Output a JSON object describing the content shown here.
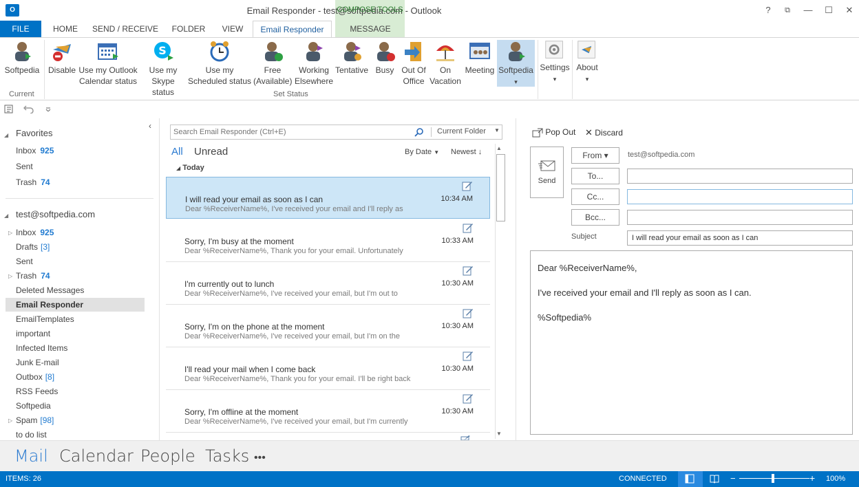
{
  "window": {
    "title": "Email Responder - test@softpedia.com - Outlook",
    "app_logo": "O",
    "contextual_tab_group": "COMPOSE TOOLS",
    "controls": {
      "help": "?",
      "ribbon_display": "⧉",
      "minimize": "—",
      "maximize": "☐",
      "close": "✕"
    }
  },
  "tabs": [
    "FILE",
    "HOME",
    "SEND / RECEIVE",
    "FOLDER",
    "VIEW",
    "Email Responder",
    "MESSAGE"
  ],
  "ribbon": {
    "current_group": "Current",
    "set_status_group": "Set Status",
    "buttons": [
      {
        "label1": "Softpedia",
        "label2": "",
        "icon": "person-status-icon"
      },
      {
        "label1": "Disable",
        "label2": "",
        "icon": "disable-icon"
      },
      {
        "label1": "Use my Outlook",
        "label2": "Calendar status",
        "icon": "calendar-icon"
      },
      {
        "label1": "Use my",
        "label2": "Skype status",
        "icon": "skype-icon"
      },
      {
        "label1": "Use my",
        "label2": "Scheduled status",
        "icon": "alarm-clock-icon"
      },
      {
        "label1": "Free",
        "label2": "(Available)",
        "icon": "person-free-icon"
      },
      {
        "label1": "Working",
        "label2": "Elsewhere",
        "icon": "person-working-elsewhere-icon"
      },
      {
        "label1": "Tentative",
        "label2": "",
        "icon": "person-tentative-icon"
      },
      {
        "label1": "Busy",
        "label2": "",
        "icon": "person-busy-icon"
      },
      {
        "label1": "Out Of",
        "label2": "Office",
        "icon": "out-of-office-icon"
      },
      {
        "label1": "On",
        "label2": "Vacation",
        "icon": "vacation-icon"
      },
      {
        "label1": "Meeting",
        "label2": "",
        "icon": "meeting-icon"
      },
      {
        "label1": "Softpedia",
        "label2": "▾",
        "icon": "person-custom-icon"
      },
      {
        "label1": "Settings",
        "label2": "▾",
        "icon": "settings-icon"
      },
      {
        "label1": "About",
        "label2": "▾",
        "icon": "about-icon"
      }
    ]
  },
  "folders": {
    "favorites_header": "Favorites",
    "favorites": [
      {
        "name": "Inbox",
        "count": "925"
      },
      {
        "name": "Sent",
        "count": ""
      },
      {
        "name": "Trash",
        "count": "74"
      }
    ],
    "account": "test@softpedia.com",
    "items": [
      {
        "name": "Inbox",
        "count": "925",
        "bracket": ""
      },
      {
        "name": "Drafts",
        "count": "",
        "bracket": "[3]"
      },
      {
        "name": "Sent",
        "count": "",
        "bracket": ""
      },
      {
        "name": "Trash",
        "count": "74",
        "bracket": ""
      },
      {
        "name": "Deleted Messages",
        "count": "",
        "bracket": ""
      },
      {
        "name": "Email Responder",
        "count": "",
        "bracket": ""
      },
      {
        "name": "EmailTemplates",
        "count": "",
        "bracket": ""
      },
      {
        "name": "important",
        "count": "",
        "bracket": ""
      },
      {
        "name": "Infected Items",
        "count": "",
        "bracket": ""
      },
      {
        "name": "Junk E-mail",
        "count": "",
        "bracket": ""
      },
      {
        "name": "Outbox",
        "count": "",
        "bracket": "[8]"
      },
      {
        "name": "RSS Feeds",
        "count": "",
        "bracket": ""
      },
      {
        "name": "Softpedia",
        "count": "",
        "bracket": ""
      },
      {
        "name": "Spam",
        "count": "",
        "bracket": "[98]"
      },
      {
        "name": "to do list",
        "count": "",
        "bracket": ""
      }
    ]
  },
  "messages": {
    "search_placeholder": "Search Email Responder (Ctrl+E)",
    "scope": "Current Folder",
    "filter_all": "All",
    "filter_unread": "Unread",
    "sort": "By Date",
    "order": "Newest",
    "group": "Today",
    "list": [
      {
        "subject": "I will read your email as soon as I can",
        "preview": "Dear %ReceiverName%,  I've received your email and I'll reply as",
        "time": "10:34 AM"
      },
      {
        "subject": "Sorry, I'm busy at the moment",
        "preview": "Dear %ReceiverName%,  Thank you for your email. Unfortunately",
        "time": "10:33 AM"
      },
      {
        "subject": "I'm currently out to lunch",
        "preview": "Dear %ReceiverName%,  I've received your email, but I'm out to",
        "time": "10:30 AM"
      },
      {
        "subject": "Sorry, I'm on the phone at the moment",
        "preview": "Dear %ReceiverName%,  I've received your email, but I'm on the",
        "time": "10:30 AM"
      },
      {
        "subject": "I'll read your mail when I come back",
        "preview": "Dear %ReceiverName%,  Thank you for your email. I'll be right back",
        "time": "10:30 AM"
      },
      {
        "subject": "Sorry, I'm offline at the moment",
        "preview": "Dear %ReceiverName%,  I've received your email, but I'm currently",
        "time": "10:30 AM"
      }
    ]
  },
  "compose": {
    "pop_out": "Pop Out",
    "discard": "Discard",
    "send": "Send",
    "from_label": "From ▾",
    "from_value": "test@softpedia.com",
    "to_label": "To...",
    "cc_label": "Cc...",
    "bcc_label": "Bcc...",
    "subject_label": "Subject",
    "subject_value": "I will read your email as soon as I can",
    "body_line1": "Dear %ReceiverName%,",
    "body_line2": "I've received your email and I'll reply as soon as I can.",
    "body_line3": "%Softpedia%"
  },
  "nav": [
    "Mail",
    "Calendar",
    "People",
    "Tasks",
    "•••"
  ],
  "status": {
    "items": "ITEMS: 26",
    "connection": "CONNECTED",
    "zoom": "100%"
  }
}
